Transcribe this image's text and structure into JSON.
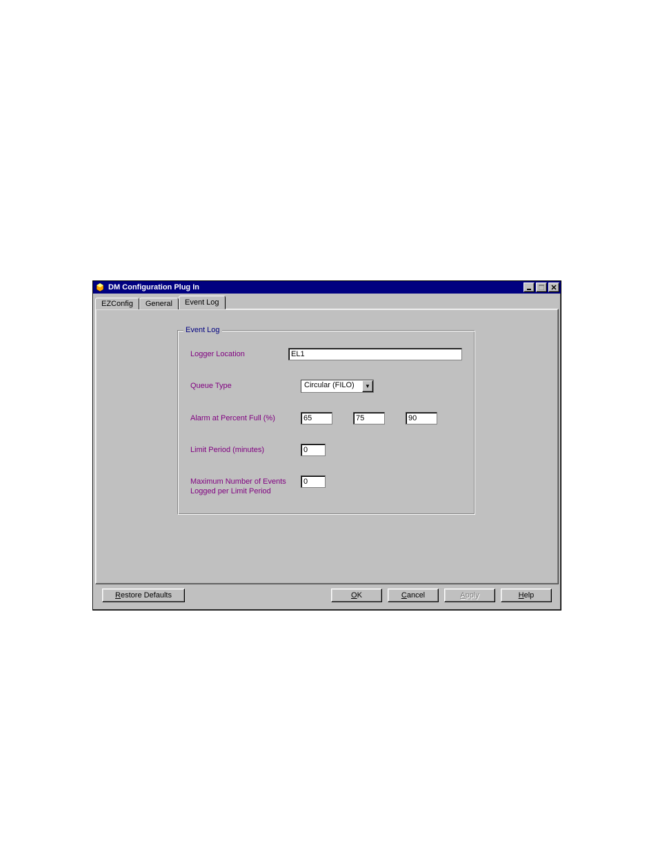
{
  "window": {
    "title": "DM Configuration Plug In",
    "icon": "app-icon"
  },
  "tabs": [
    {
      "label": "EZConfig",
      "active": false
    },
    {
      "label": "General",
      "active": false
    },
    {
      "label": "Event Log",
      "active": true
    }
  ],
  "groupbox": {
    "title": "Event Log"
  },
  "fields": {
    "logger_location": {
      "label": "Logger Location",
      "value": "EL1"
    },
    "queue_type": {
      "label": "Queue Type",
      "value": "Circular (FILO)"
    },
    "alarm_percent": {
      "label": "Alarm at Percent Full (%)",
      "v1": "65",
      "v2": "75",
      "v3": "90"
    },
    "limit_period": {
      "label": "Limit Period (minutes)",
      "value": "0"
    },
    "max_events": {
      "label": "Maximum Number of Events Logged per Limit Period",
      "value": "0"
    }
  },
  "buttons": {
    "restore_defaults": "Restore Defaults",
    "ok": "OK",
    "cancel": "Cancel",
    "apply": "Apply",
    "help": "Help"
  }
}
